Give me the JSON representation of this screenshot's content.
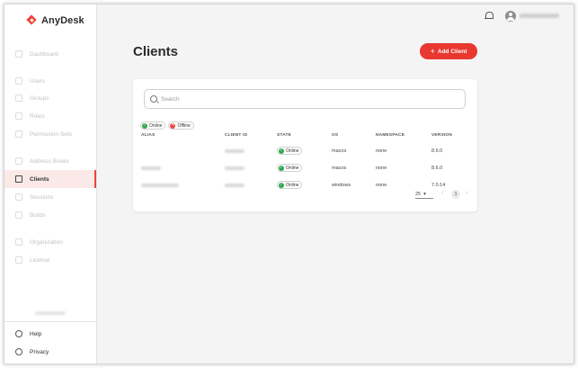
{
  "app": {
    "name": "AnyDesk"
  },
  "sidebar": {
    "items": [
      {
        "label": "Dashboard",
        "icon": "grid-icon"
      },
      {
        "label": "Users",
        "icon": "user-icon"
      },
      {
        "label": "Groups",
        "icon": "group-icon"
      },
      {
        "label": "Roles",
        "icon": "roles-icon"
      },
      {
        "label": "Permission Sets",
        "icon": "permission-icon"
      },
      {
        "label": "Address Books",
        "icon": "address-book-icon"
      },
      {
        "label": "Clients",
        "icon": "monitor-icon"
      },
      {
        "label": "Sessions",
        "icon": "sessions-icon"
      },
      {
        "label": "Builds",
        "icon": "builds-icon"
      },
      {
        "label": "Organization",
        "icon": "organization-icon"
      },
      {
        "label": "License",
        "icon": "license-icon"
      }
    ],
    "active": "Clients",
    "bottom": [
      {
        "label": "Help",
        "icon": "help-icon"
      },
      {
        "label": "Privacy",
        "icon": "shield-icon"
      }
    ]
  },
  "header": {
    "title": "Clients",
    "add_button": "Add Client"
  },
  "search": {
    "placeholder": "Search"
  },
  "filters": {
    "online": "Online",
    "offline": "Offline"
  },
  "table": {
    "columns": [
      "ALIAS",
      "CLIENT ID",
      "STATE",
      "OS",
      "NAMESPACE",
      "VERSION"
    ],
    "rows": [
      {
        "state": "Online",
        "os": "macos",
        "namespace": "none",
        "version": "8.6.0"
      },
      {
        "state": "Online",
        "os": "macos",
        "namespace": "none",
        "version": "8.6.0"
      },
      {
        "state": "Online",
        "os": "windows",
        "namespace": "none",
        "version": "7.0.14"
      }
    ]
  },
  "pagination": {
    "per_page": "25",
    "current_page": "1"
  },
  "colors": {
    "accent": "#e8382f",
    "online": "#2fa84f",
    "offline": "#e5483f"
  }
}
